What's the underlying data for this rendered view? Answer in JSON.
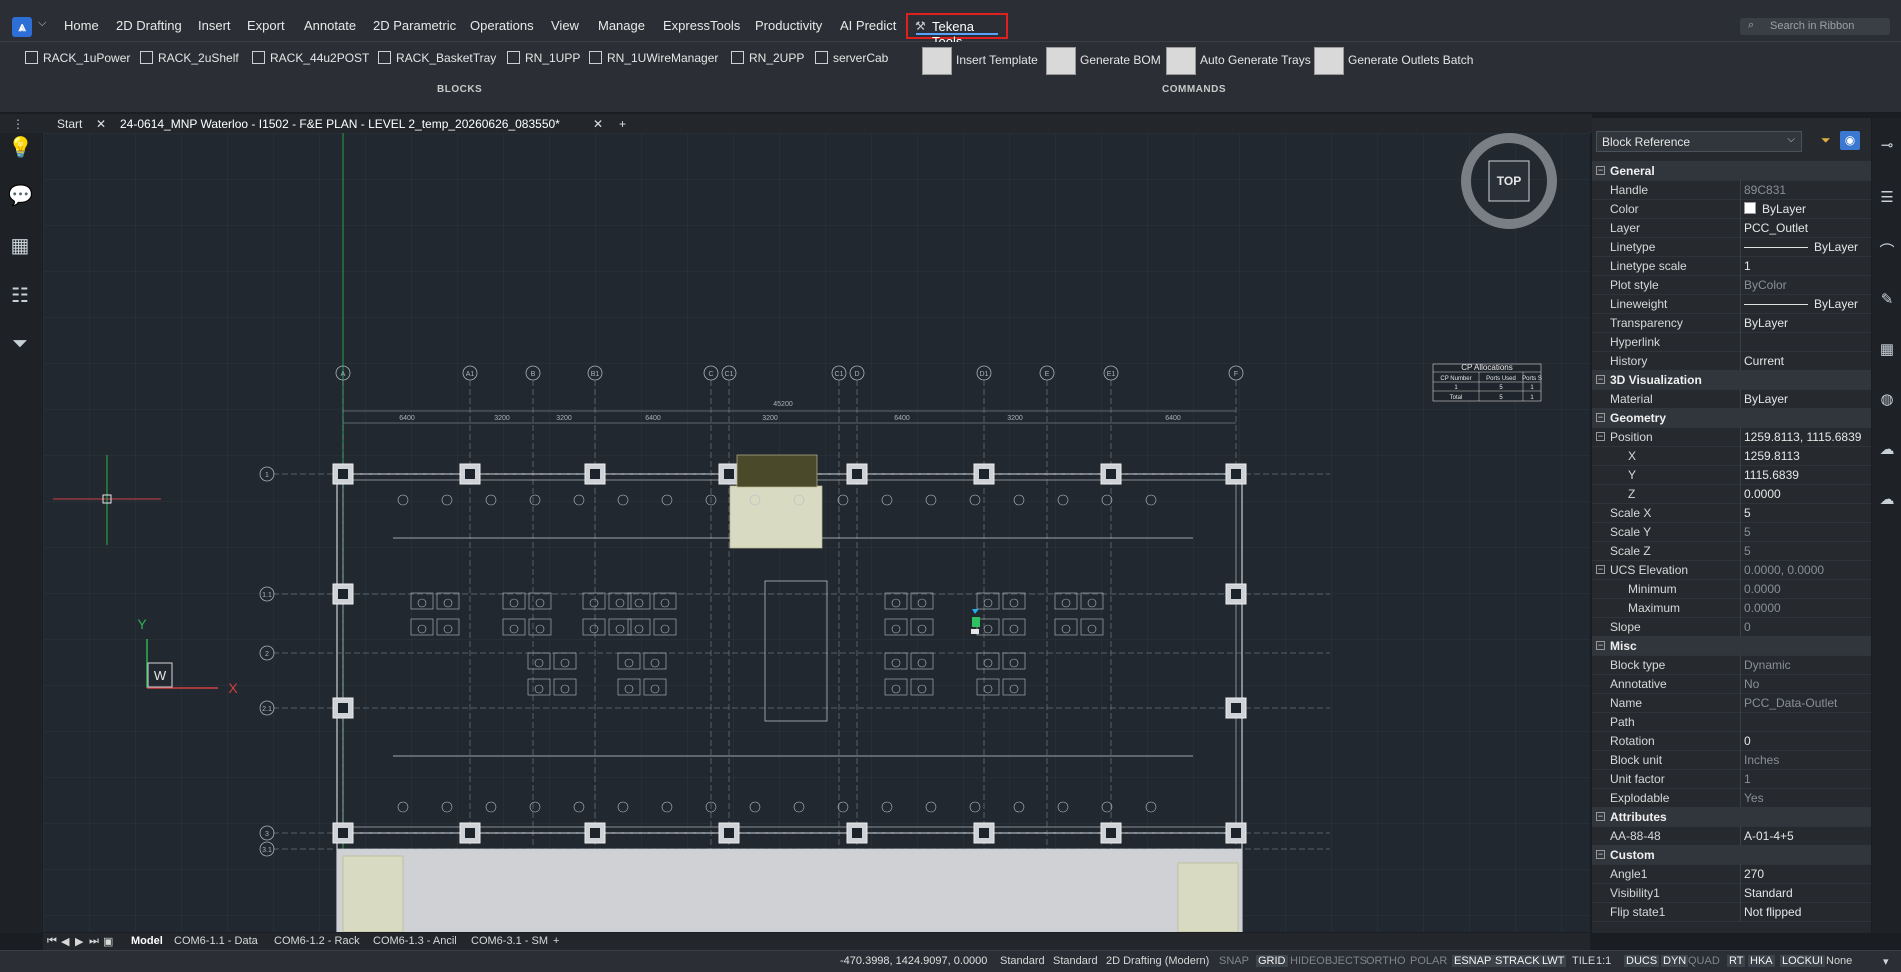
{
  "menubar": {
    "items": [
      "Home",
      "2D Drafting",
      "Insert",
      "Export",
      "Annotate",
      "2D Parametric",
      "Operations",
      "View",
      "Manage",
      "ExpressTools",
      "Productivity",
      "AI Predict"
    ],
    "active_tab": "Tekena Tools",
    "search_placeholder": "Search in Ribbon"
  },
  "ribbon": {
    "blocks": [
      "RACK_1uPower",
      "RACK_2uShelf",
      "RACK_44u2POST",
      "RACK_BasketTray",
      "RN_1UPP",
      "RN_1UWireManager",
      "RN_2UPP",
      "serverCab"
    ],
    "blocks_label": "BLOCKS",
    "commands": [
      "Insert Template",
      "Generate BOM",
      "Auto Generate Trays",
      "Generate Outlets Batch"
    ],
    "commands_label": "COMMANDS"
  },
  "doctabs": {
    "start": "Start",
    "drawing": "24-0614_MNP Waterloo - I1502 - F&E PLAN - LEVEL 2_temp_20260626_083550*",
    "add": "+"
  },
  "viewport": {
    "viewcube": "TOP",
    "ucs_y": "Y",
    "ucs_x": "X",
    "ucs_w": "W",
    "cp_table": {
      "title": "CP Allocations",
      "headers": [
        "CP Number",
        "Ports Used",
        "Ports S"
      ],
      "rows": [
        [
          "1",
          "5",
          "1"
        ],
        [
          "Total",
          "5",
          "1"
        ]
      ]
    },
    "grid_cols": [
      "A",
      "A1",
      "B",
      "B1",
      "C",
      "C1",
      "C1",
      "D",
      "D1",
      "E",
      "E1",
      "F"
    ],
    "grid_rows": [
      "1",
      "1.1",
      "2",
      "2.1",
      "3",
      "3.1"
    ],
    "overall_dim": "45200",
    "dims": [
      "6400",
      "3200",
      "3200",
      "6400",
      "3200",
      "6400",
      "3200",
      "6400"
    ]
  },
  "props": {
    "type": "Block Reference",
    "rows": [
      {
        "sec": true,
        "k": "General"
      },
      {
        "k": "Handle",
        "v": "89C831",
        "dim": true
      },
      {
        "k": "Color",
        "v": "ByLayer",
        "swatch": true
      },
      {
        "k": "Layer",
        "v": "PCC_Outlet"
      },
      {
        "k": "Linetype",
        "v": "ByLayer",
        "line": true
      },
      {
        "k": "Linetype scale",
        "v": "1"
      },
      {
        "k": "Plot style",
        "v": "ByColor",
        "dim": true
      },
      {
        "k": "Lineweight",
        "v": "ByLayer",
        "line": true
      },
      {
        "k": "Transparency",
        "v": "ByLayer"
      },
      {
        "k": "Hyperlink",
        "v": ""
      },
      {
        "k": "History",
        "v": "Current"
      },
      {
        "sec": true,
        "k": "3D Visualization"
      },
      {
        "k": "Material",
        "v": "ByLayer"
      },
      {
        "sec": true,
        "k": "Geometry"
      },
      {
        "k": "Position",
        "v": "1259.8113, 1115.6839",
        "box": true
      },
      {
        "k": "X",
        "v": "1259.8113",
        "indent": true
      },
      {
        "k": "Y",
        "v": "1115.6839",
        "indent": true
      },
      {
        "k": "Z",
        "v": "0.0000",
        "indent": true
      },
      {
        "k": "Scale X",
        "v": "5"
      },
      {
        "k": "Scale Y",
        "v": "5",
        "dim": true
      },
      {
        "k": "Scale Z",
        "v": "5",
        "dim": true
      },
      {
        "k": "UCS Elevation",
        "v": "0.0000, 0.0000",
        "dim": true,
        "box": true
      },
      {
        "k": "Minimum",
        "v": "0.0000",
        "dim": true,
        "indent": true
      },
      {
        "k": "Maximum",
        "v": "0.0000",
        "dim": true,
        "indent": true
      },
      {
        "k": "Slope",
        "v": "0",
        "dim": true
      },
      {
        "sec": true,
        "k": "Misc"
      },
      {
        "k": "Block type",
        "v": "Dynamic",
        "dim": true
      },
      {
        "k": "Annotative",
        "v": "No",
        "dim": true
      },
      {
        "k": "Name",
        "v": "PCC_Data-Outlet",
        "dim": true
      },
      {
        "k": "Path",
        "v": ""
      },
      {
        "k": "Rotation",
        "v": "0"
      },
      {
        "k": "Block unit",
        "v": "Inches",
        "dim": true
      },
      {
        "k": "Unit factor",
        "v": "1",
        "dim": true
      },
      {
        "k": "Explodable",
        "v": "Yes",
        "dim": true
      },
      {
        "sec": true,
        "k": "Attributes"
      },
      {
        "k": "AA-88-48",
        "v": "A-01-4+5"
      },
      {
        "sec": true,
        "k": "Custom"
      },
      {
        "k": "Angle1",
        "v": "270"
      },
      {
        "k": "Visibility1",
        "v": "Standard"
      },
      {
        "k": "Flip state1",
        "v": "Not flipped"
      }
    ]
  },
  "layouttabs": [
    "Model",
    "COM6-1.1 - Data",
    "COM6-1.2 - Rack",
    "COM6-1.3 - Ancil",
    "COM6-3.1 - SM",
    "+"
  ],
  "status": {
    "coords": "-470.3998, 1424.9097, 0.0000",
    "items": [
      {
        "t": "Standard",
        "s": "n"
      },
      {
        "t": "Standard",
        "s": "n"
      },
      {
        "t": "2D Drafting (Modern)",
        "s": "n"
      },
      {
        "t": "SNAP",
        "s": "off"
      },
      {
        "t": "GRID",
        "s": "on"
      },
      {
        "t": "HIDEOBJECTS",
        "s": "off"
      },
      {
        "t": "ORTHO",
        "s": "off"
      },
      {
        "t": "POLAR",
        "s": "off"
      },
      {
        "t": "ESNAP",
        "s": "on"
      },
      {
        "t": "STRACK",
        "s": "on"
      },
      {
        "t": "LWT",
        "s": "on"
      },
      {
        "t": "TILE",
        "s": "n"
      },
      {
        "t": "1:1",
        "s": "n"
      },
      {
        "t": "DUCS",
        "s": "on"
      },
      {
        "t": "DYN",
        "s": "on"
      },
      {
        "t": "QUAD",
        "s": "off"
      },
      {
        "t": "RT",
        "s": "on"
      },
      {
        "t": "HKA",
        "s": "on"
      },
      {
        "t": "LOCKUI",
        "s": "on"
      },
      {
        "t": "None",
        "s": "n"
      }
    ]
  }
}
